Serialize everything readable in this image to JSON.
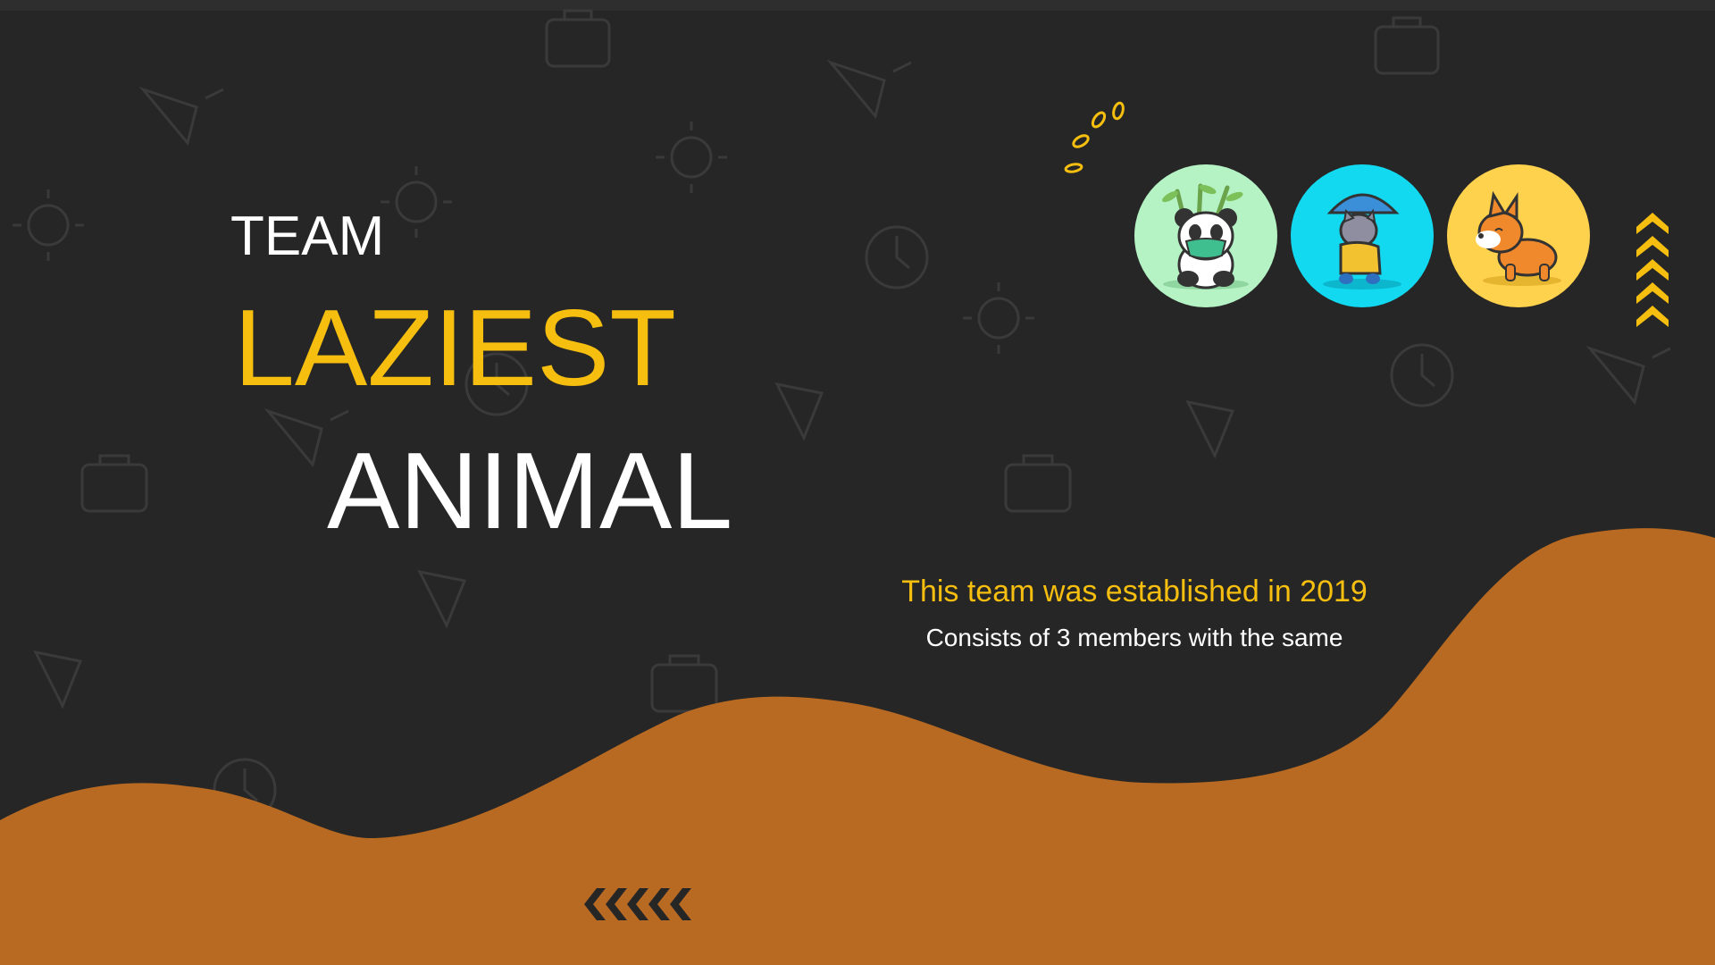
{
  "slide": {
    "title_top": "TEAM",
    "title_highlight": "LAZIEST",
    "title_bottom": "ANIMAL",
    "established": "This team was established in 2019",
    "members": "Consists of 3 members with the same"
  },
  "members": [
    {
      "icon": "panda-icon",
      "bg": "#b5f2c4"
    },
    {
      "icon": "cat-umbrella-icon",
      "bg": "#12d8f0"
    },
    {
      "icon": "corgi-icon",
      "bg": "#ffd24d"
    }
  ],
  "colors": {
    "background": "#262626",
    "wave": "#b86a22",
    "accent": "#f6be0f",
    "text": "#ffffff",
    "chevrons_dark": "#262626"
  },
  "icons": [
    "sparkle-icon",
    "chevrons-up-icon",
    "chevrons-left-icon"
  ]
}
